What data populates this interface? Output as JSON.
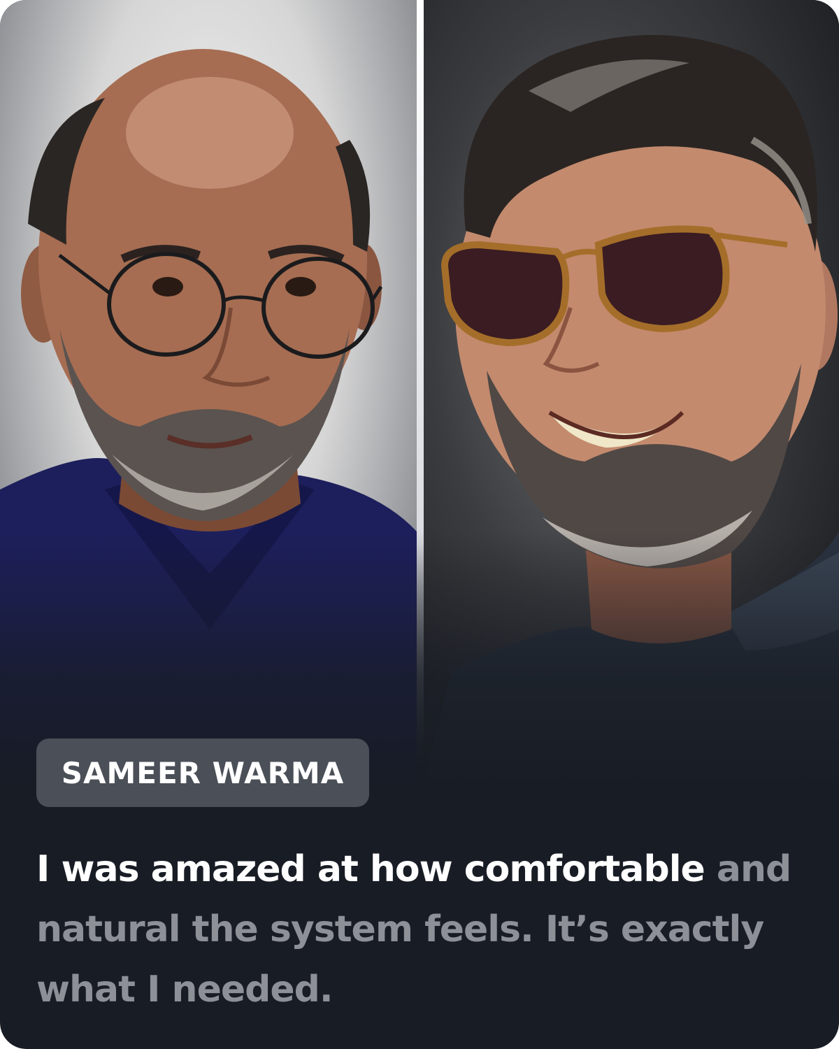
{
  "testimonial": {
    "name": "SAMEER WARMA",
    "quote_highlight": "I was amazed at how comfortable",
    "quote_rest": " and natural the system feels. It’s exactly what I needed."
  },
  "photos": {
    "before": {
      "subject": "bald man with round glasses and grey beard, navy polo"
    },
    "after": {
      "subject": "smiling man with full hair, sunglasses and grey beard"
    }
  },
  "colors": {
    "card_background": "#181c24",
    "badge_background": "#4b4f57",
    "quote_highlight": "#ffffff",
    "quote_dim": "#8d9097"
  }
}
